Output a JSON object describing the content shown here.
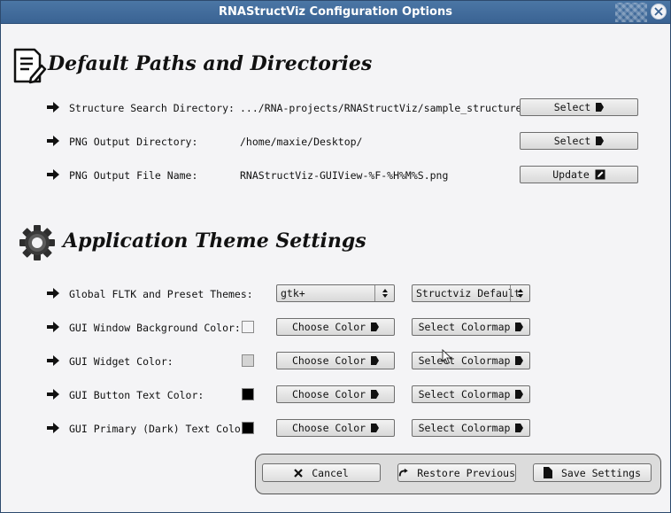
{
  "window": {
    "title": "RNAStructViz Configuration Options"
  },
  "paths_section": {
    "title": "Default Paths and Directories",
    "icon": "document-edit-icon",
    "rows": [
      {
        "label": "Structure Search Directory:",
        "value": ".../RNA-projects/RNAStructViz/sample_structures",
        "button": "Select",
        "button_icon": "triangle-right-icon"
      },
      {
        "label": "PNG Output Directory:",
        "value": "/home/maxie/Desktop/",
        "button": "Select",
        "button_icon": "triangle-right-icon"
      },
      {
        "label": "PNG Output File Name:",
        "value": "RNAStructViz-GUIView-%F-%H%M%S.png",
        "button": "Update",
        "button_icon": "edit-box-icon"
      }
    ]
  },
  "theme_section": {
    "title": "Application Theme Settings",
    "icon": "gear-icon",
    "theme_row": {
      "label": "Global FLTK and Preset Themes:",
      "fltk_theme": "gtk+",
      "preset_theme": "Structviz Default"
    },
    "color_rows": [
      {
        "label": "GUI Window Background Color:",
        "swatch": "#f4f4f6",
        "choose": "Choose Color",
        "colormap": "Select Colormap"
      },
      {
        "label": "GUI Widget Color:",
        "swatch": "#d4d4d4",
        "choose": "Choose Color",
        "colormap": "Select Colormap"
      },
      {
        "label": "GUI Button Text Color:",
        "swatch": "#000000",
        "choose": "Choose Color",
        "colormap": "Select Colormap"
      },
      {
        "label": "GUI Primary (Dark) Text Color:",
        "swatch": "#000000",
        "choose": "Choose Color",
        "colormap": "Select Colormap"
      }
    ]
  },
  "footer": {
    "cancel": "Cancel",
    "restore": "Restore Previous",
    "save": "Save Settings"
  }
}
